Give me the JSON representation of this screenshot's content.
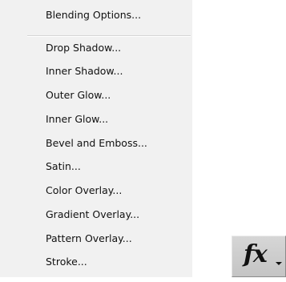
{
  "menu": {
    "items": [
      {
        "label": "Blending Options..."
      },
      {
        "label": "Drop Shadow..."
      },
      {
        "label": "Inner Shadow..."
      },
      {
        "label": "Outer Glow..."
      },
      {
        "label": "Inner Glow..."
      },
      {
        "label": "Bevel and Emboss..."
      },
      {
        "label": "Satin..."
      },
      {
        "label": "Color Overlay..."
      },
      {
        "label": "Gradient Overlay..."
      },
      {
        "label": "Pattern Overlay..."
      },
      {
        "label": "Stroke..."
      }
    ]
  },
  "fx_button": {
    "glyph": "fx",
    "icon": "fx-layer-style-icon"
  },
  "colors": {
    "menu_background": "#f1f1f1",
    "button_background": "#cdcdcd",
    "text": "#111111"
  }
}
